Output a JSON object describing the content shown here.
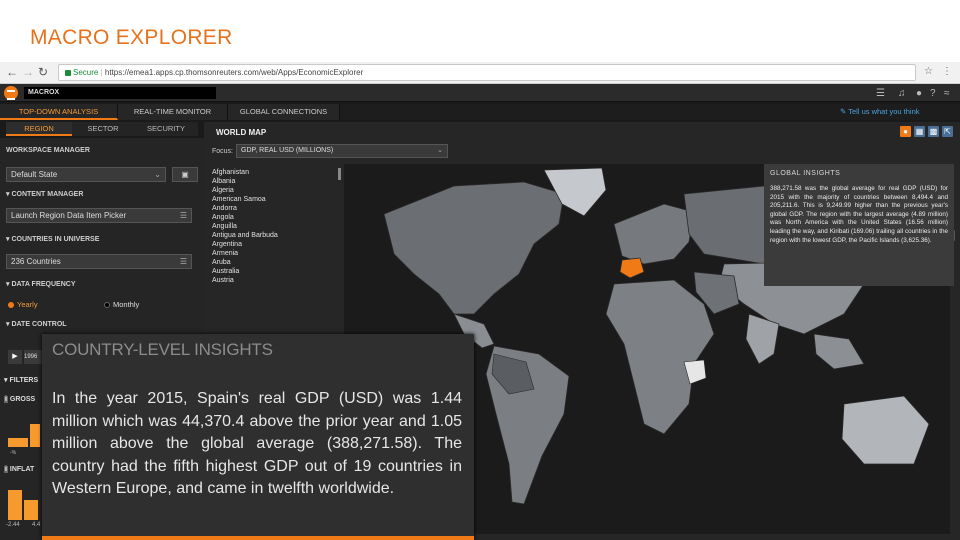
{
  "slide": {
    "title": "MACRO EXPLORER"
  },
  "browser": {
    "secure_label": "Secure",
    "url": "https://emea1.apps.cp.thomsonreuters.com/web/Apps/EconomicExplorer",
    "back_icon": "arrow-left-icon",
    "forward_icon": "arrow-right-icon",
    "reload_icon": "reload-icon"
  },
  "app": {
    "search_value": "MACROX",
    "main_tabs": [
      {
        "label": "TOP-DOWN ANALYSIS",
        "active": true
      },
      {
        "label": "REAL-TIME MONITOR",
        "active": false
      },
      {
        "label": "GLOBAL CONNECTIONS",
        "active": false
      }
    ],
    "sub_tabs": [
      {
        "label": "REGION",
        "active": true
      },
      {
        "label": "SECTOR",
        "active": false
      },
      {
        "label": "SECURITY",
        "active": false
      }
    ],
    "feedback_link": "Tell us what you think",
    "accent": "#f07a16"
  },
  "left_panel": {
    "workspace_manager": "WORKSPACE MANAGER",
    "workspace_value": "Default State",
    "content_manager": "CONTENT MANAGER",
    "content_value": "Launch Region Data Item Picker",
    "countries_universe": "COUNTRIES IN UNIVERSE",
    "countries_value": "236 Countries",
    "data_frequency": "DATA FREQUENCY",
    "freq_yearly": "Yearly",
    "freq_monthly": "Monthly",
    "date_control": "DATE CONTROL",
    "play_value": "1996",
    "filters": "FILTERS",
    "gross_label": "GROSS",
    "inflation_label": "INFLAT",
    "tick_a": "-%",
    "tick_b": "-2.44",
    "tick_c": "4.4"
  },
  "map": {
    "title": "WORLD MAP",
    "focus_label": "Focus:",
    "focus_value": "GDP, REAL USD (MILLIONS)",
    "countries": [
      "Afghanistan",
      "Albania",
      "Algeria",
      "American Samoa",
      "Andorra",
      "Angola",
      "Anguilla",
      "Antigua and Barbuda",
      "Argentina",
      "Armenia",
      "Aruba",
      "Australia",
      "Austria"
    ],
    "highlight_color": "#f07a16"
  },
  "global_insights": {
    "title": "GLOBAL INSIGHTS",
    "text": "388,271.58 was the global average for real GDP (USD) for 2015 with the majority of countries between 8,494.4 and 205,211.6. This is 9,249.99 higher than the previous year's global GDP. The region with the largest average (4.89 million) was North America with the United States (16.56 million) leading the way, and Kiribati (169.06) trailing all countries in the region with the lowest GDP, the Pacific Islands (3,625.36)."
  },
  "country_insights": {
    "title": "COUNTRY-LEVEL INSIGHTS",
    "text": "In the year 2015, Spain's real GDP (USD) was 1.44 million which was 44,370.4 above the prior year and 1.05 million above the global average (388,271.58). The country had the fifth highest GDP out of 19 countries in Western Europe, and came in twelfth worldwide."
  }
}
